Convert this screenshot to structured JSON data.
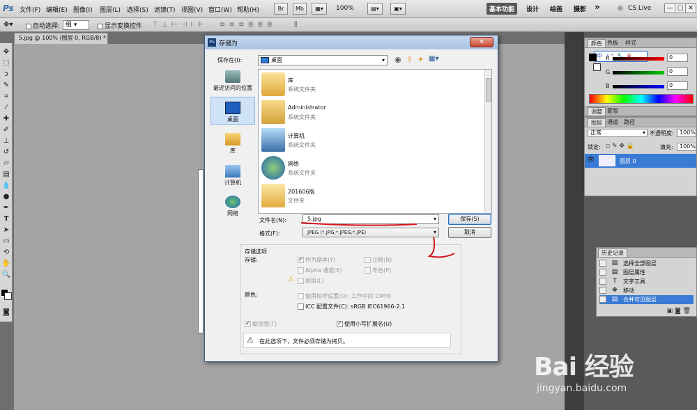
{
  "menubar": {
    "app": "Ps",
    "menus": [
      "文件(F)",
      "编辑(E)",
      "图像(I)",
      "图层(L)",
      "选择(S)",
      "滤镜(T)",
      "视图(V)",
      "窗口(W)",
      "帮助(H)"
    ],
    "br": "Br",
    "mb": "Mb",
    "zoom": "100%",
    "workspaces": [
      "基本功能",
      "设计",
      "绘画",
      "摄影"
    ],
    "more": "»",
    "cslive": "CS Live",
    "win_min": "—",
    "win_max": "□",
    "win_close": "✕"
  },
  "options": {
    "auto_select": "自动选择:",
    "auto_select_value": "组",
    "show_transform": "显示变换控件"
  },
  "doc_tab": "5.jpg @ 100% (图层 0, RGB/8) *",
  "dialog": {
    "title": "存储为",
    "app_icon": "Ps",
    "close": "✕",
    "save_in_label": "保存在(I):",
    "save_in_value": "桌面",
    "places": [
      {
        "label": "最近访问的位置"
      },
      {
        "label": "桌面"
      },
      {
        "label": "库"
      },
      {
        "label": "计算机"
      },
      {
        "label": "网络"
      }
    ],
    "files": [
      {
        "name": "库",
        "type": "系统文件夹"
      },
      {
        "name": "Administrator",
        "type": "系统文件夹"
      },
      {
        "name": "计算机",
        "type": "系统文件夹"
      },
      {
        "name": "网络",
        "type": "系统文件夹"
      },
      {
        "name": "201606版",
        "type": "文件夹"
      }
    ],
    "filename_label": "文件名(N):",
    "filename_value": "5.jpg",
    "format_label": "格式(F):",
    "format_value": "JPEG (*.JPG;*.JPEG;*.JPE)",
    "save_button": "保存(S)",
    "cancel_button": "取消",
    "options_title": "存储选项",
    "store_label": "存储:",
    "opt_copy": "作为副本(Y)",
    "opt_notes": "注释(N)",
    "opt_alpha": "Alpha 通道(E)",
    "opt_spot": "专色(P)",
    "opt_layers": "图层(L)",
    "color_label": "颜色:",
    "opt_proof": "使用校样设置(O):",
    "opt_proof_value": "工作中的 CMYK",
    "opt_icc": "ICC 配置文件(C):",
    "opt_icc_value": "sRGB IEC61966-2.1",
    "opt_thumbnail": "缩览图(T)",
    "opt_lowercase": "使用小写扩展名(U)",
    "warning": "在此选项下，文件必须存储为拷贝。"
  },
  "color_panel": {
    "tabs": [
      "颜色",
      "色板",
      "样式"
    ],
    "r_label": "R",
    "g_label": "G",
    "b_label": "B",
    "r": "0",
    "g": "0",
    "b": "0",
    "ime": "中 ☽ °, 🔧 🀄"
  },
  "adjust_panel": {
    "tabs": [
      "调整",
      "蒙版"
    ]
  },
  "layers_panel": {
    "tabs": [
      "图层",
      "通道",
      "路径"
    ],
    "blend_mode": "正常",
    "opacity_label": "不透明度:",
    "opacity": "100%",
    "lock_label": "锁定:",
    "fill_label": "填充:",
    "fill": "100%",
    "layer_name": "图层 0"
  },
  "history_panel": {
    "title": "历史记录",
    "items": [
      "选择全部图层",
      "图层属性",
      "文字工具",
      "移动",
      "合并可见图层"
    ]
  },
  "watermark": {
    "main": "Bai 经验",
    "sub": "jingyan.baidu.com"
  },
  "colors": {
    "accent_blue": "#3a7bd5",
    "annotation_red": "#d4141c"
  }
}
